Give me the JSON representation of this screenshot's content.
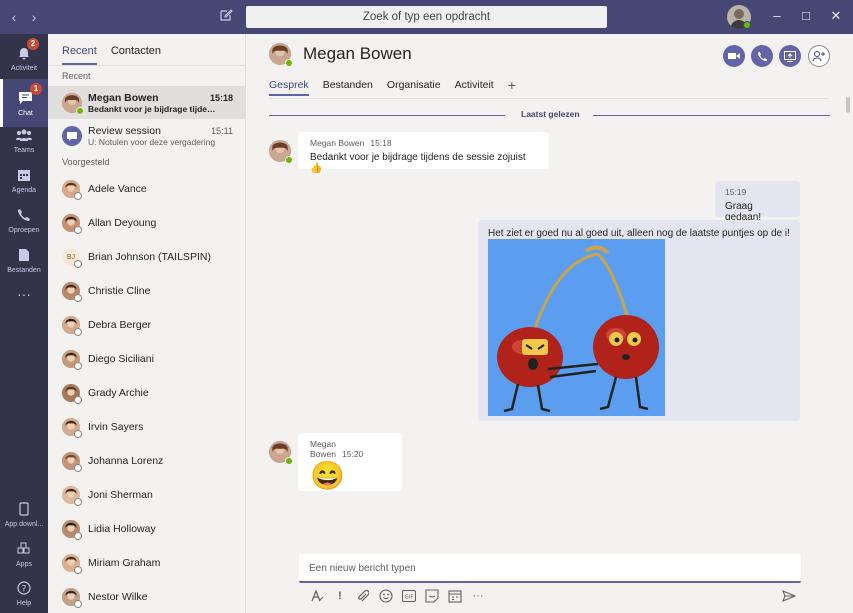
{
  "titlebar": {
    "search_placeholder": "Zoek of typ een opdracht",
    "back_glyph": "‹",
    "forward_glyph": "›",
    "minimize_glyph": "–",
    "maximize_glyph": "□",
    "close_glyph": "✕"
  },
  "appbar": {
    "items": [
      {
        "label": "Activiteit",
        "icon": "bell-icon",
        "badge": "2"
      },
      {
        "label": "Chat",
        "icon": "chat-icon",
        "badge": "1"
      },
      {
        "label": "Teams",
        "icon": "teams-icon"
      },
      {
        "label": "Agenda",
        "icon": "calendar-icon"
      },
      {
        "label": "Oproepen",
        "icon": "phone-icon"
      },
      {
        "label": "Bestanden",
        "icon": "files-icon"
      },
      {
        "label": "···",
        "icon": "more-icon"
      }
    ],
    "bottom_items": [
      {
        "label": "App downl...",
        "icon": "mobile-icon"
      },
      {
        "label": "Apps",
        "icon": "apps-icon"
      },
      {
        "label": "Help",
        "icon": "help-icon"
      }
    ]
  },
  "chatlist": {
    "tabs": [
      "Recent",
      "Contacten"
    ],
    "recent_label": "Recent",
    "suggested_label": "Voorgesteld",
    "recent": [
      {
        "name": "Megan Bowen",
        "preview": "Bedankt voor je bijdrage tijdens de sessie zojuist",
        "time": "15:18"
      },
      {
        "name": "Review session",
        "preview": "U: Notulen voor deze vergadering",
        "time": "15:11"
      }
    ],
    "suggested": [
      "Adele Vance",
      "Allan Deyoung",
      "Brian Johnson (TAILSPIN)",
      "Christie Cline",
      "Debra Berger",
      "Diego Siciliani",
      "Grady Archie",
      "Irvin Sayers",
      "Johanna Lorenz",
      "Joni Sherman",
      "Lidia Holloway",
      "Miriam Graham",
      "Nestor Wilke"
    ],
    "brian_initials": "BJ"
  },
  "conversation": {
    "contact_name": "Megan Bowen",
    "tabs": [
      "Gesprek",
      "Bestanden",
      "Organisatie",
      "Activiteit"
    ],
    "add_tab": "+",
    "last_read": "Laatst gelezen",
    "messages": [
      {
        "sender": "Megan Bowen",
        "time": "15:18",
        "text": "Bedankt voor je bijdrage tijdens de sessie zojuist 👍"
      },
      {
        "time": "15:19",
        "text": "Graag gedaan!"
      },
      {
        "text": "Het ziet er goed nu al goed uit, alleen nog de laatste puntjes op de i!"
      },
      {
        "sender": "Megan Bowen",
        "time": "15:20",
        "text": "😄"
      }
    ],
    "compose_placeholder": "Een nieuw bericht typen",
    "more_glyph": "···"
  },
  "colors": {
    "accent": "#6264a7",
    "titlebar": "#464775",
    "appbar": "#33344a",
    "gif_bg": "#5b9ef0"
  }
}
